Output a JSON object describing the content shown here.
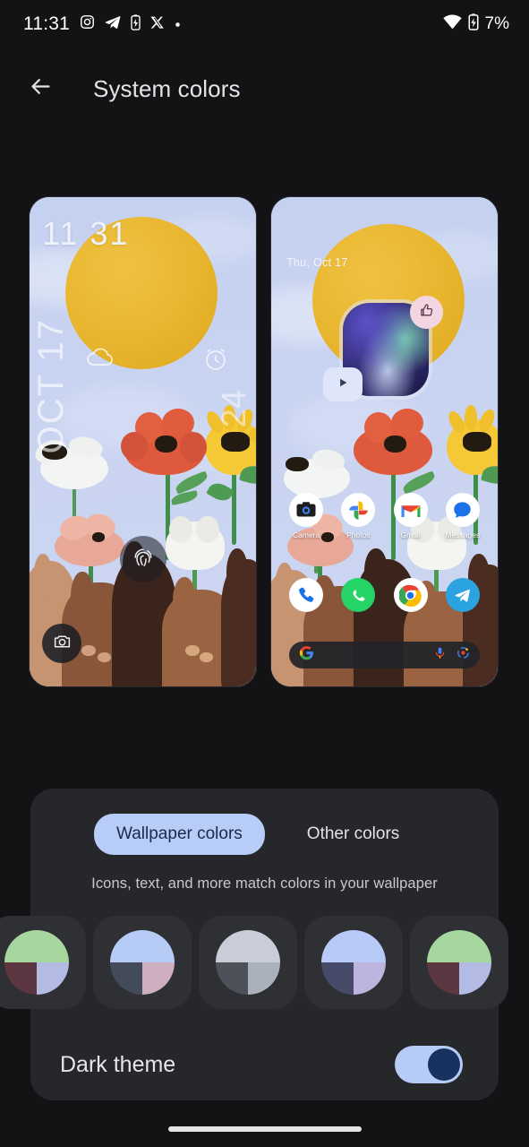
{
  "status_bar": {
    "time": "11:31",
    "battery_percent": "7%",
    "notification_icons": [
      "instagram-icon",
      "telegram-icon",
      "battery-charging-icon",
      "x-twitter-icon",
      "dot-icon"
    ],
    "right_icons": [
      "wifi-icon",
      "battery-charging-icon"
    ]
  },
  "app_bar": {
    "back_icon": "arrow-back-icon",
    "title": "System colors"
  },
  "previews": {
    "lock_screen": {
      "clock": "11 31",
      "date_vertical": "OCT 17",
      "date_vertical_right": "24",
      "weather_icon": "cloud-icon",
      "alarm_icon": "alarm-clock-icon",
      "fingerprint_icon": "fingerprint-icon",
      "camera_shortcut_icon": "camera-icon"
    },
    "home_screen": {
      "date": "Thu, Oct 17",
      "media_widget": {
        "thumbs_up_icon": "thumbs-up-icon",
        "play_icon": "play-icon"
      },
      "apps": [
        {
          "label": "Camera",
          "icon": "camera-app-icon"
        },
        {
          "label": "Photos",
          "icon": "google-photos-icon"
        },
        {
          "label": "Gmail",
          "icon": "gmail-icon"
        },
        {
          "label": "Messages",
          "icon": "google-messages-icon"
        }
      ],
      "dock": [
        {
          "label": "Phone",
          "icon": "phone-icon"
        },
        {
          "label": "WhatsApp",
          "icon": "whatsapp-icon"
        },
        {
          "label": "Chrome",
          "icon": "chrome-icon"
        },
        {
          "label": "Telegram",
          "icon": "telegram-icon"
        }
      ],
      "search_bar": {
        "logo_icon": "google-g-icon",
        "mic_icon": "microphone-icon",
        "lens_icon": "google-lens-icon"
      }
    }
  },
  "color_picker": {
    "tabs": [
      {
        "label": "Wallpaper colors",
        "selected": true
      },
      {
        "label": "Other colors",
        "selected": false
      }
    ],
    "hint": "Icons, text, and more match colors in your wallpaper",
    "swatches": [
      {
        "name": "swatch-green",
        "top": "#a6d79f",
        "bottom_left": "#5c3742",
        "bottom_right": "#b3bbe4",
        "selected": false
      },
      {
        "name": "swatch-blue",
        "top": "#b6cbf5",
        "bottom_left": "#434b5b",
        "bottom_right": "#ceaec1",
        "selected": false
      },
      {
        "name": "swatch-gray",
        "top": "#c9cdd7",
        "bottom_left": "#4c515a",
        "bottom_right": "#abb1bb",
        "selected": false
      },
      {
        "name": "swatch-periwinkle",
        "top": "#b7caf8",
        "bottom_left": "#464b69",
        "bottom_right": "#beb5de",
        "selected": false
      },
      {
        "name": "swatch-green-2",
        "top": "#a6d79f",
        "bottom_left": "#5c3742",
        "bottom_right": "#b3bbe4",
        "selected": false
      }
    ]
  },
  "dark_theme": {
    "label": "Dark theme",
    "enabled": true,
    "track_color": "#b6cbf5",
    "knob_color": "#17325f"
  },
  "navigation": {
    "gesture_pill": "home-gesture-pill"
  }
}
